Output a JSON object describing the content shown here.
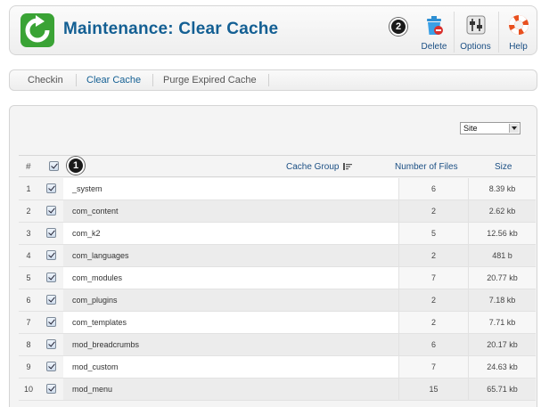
{
  "header": {
    "title": "Maintenance: Clear Cache",
    "buttons": {
      "delete": "Delete",
      "options": "Options",
      "help": "Help"
    },
    "callout": "2"
  },
  "submenu": {
    "items": [
      "Checkin",
      "Clear Cache",
      "Purge Expired Cache"
    ],
    "active": "Clear Cache"
  },
  "filter": {
    "client_selected": "Site"
  },
  "table": {
    "callout": "1",
    "headers": {
      "num": "#",
      "group": "Cache Group",
      "files": "Number of Files",
      "size": "Size"
    },
    "rows": [
      {
        "num": "1",
        "group": "_system",
        "files": "6",
        "size": "8.39 kb"
      },
      {
        "num": "2",
        "group": "com_content",
        "files": "2",
        "size": "2.62 kb"
      },
      {
        "num": "3",
        "group": "com_k2",
        "files": "5",
        "size": "12.56 kb"
      },
      {
        "num": "4",
        "group": "com_languages",
        "files": "2",
        "size": "481 b"
      },
      {
        "num": "5",
        "group": "com_modules",
        "files": "7",
        "size": "20.77 kb"
      },
      {
        "num": "6",
        "group": "com_plugins",
        "files": "2",
        "size": "7.18 kb"
      },
      {
        "num": "7",
        "group": "com_templates",
        "files": "2",
        "size": "7.71 kb"
      },
      {
        "num": "8",
        "group": "mod_breadcrumbs",
        "files": "6",
        "size": "20.17 kb"
      },
      {
        "num": "9",
        "group": "mod_custom",
        "files": "7",
        "size": "24.63 kb"
      },
      {
        "num": "10",
        "group": "mod_menu",
        "files": "15",
        "size": "65.71 kb"
      }
    ]
  },
  "colors": {
    "title": "#135f93",
    "link": "#1b4f84",
    "logo": "#3aa335"
  },
  "icons": [
    "refresh-logo-icon",
    "trash-icon",
    "options-icon",
    "lifebuoy-icon",
    "sort-icon",
    "checkbox-icon"
  ]
}
